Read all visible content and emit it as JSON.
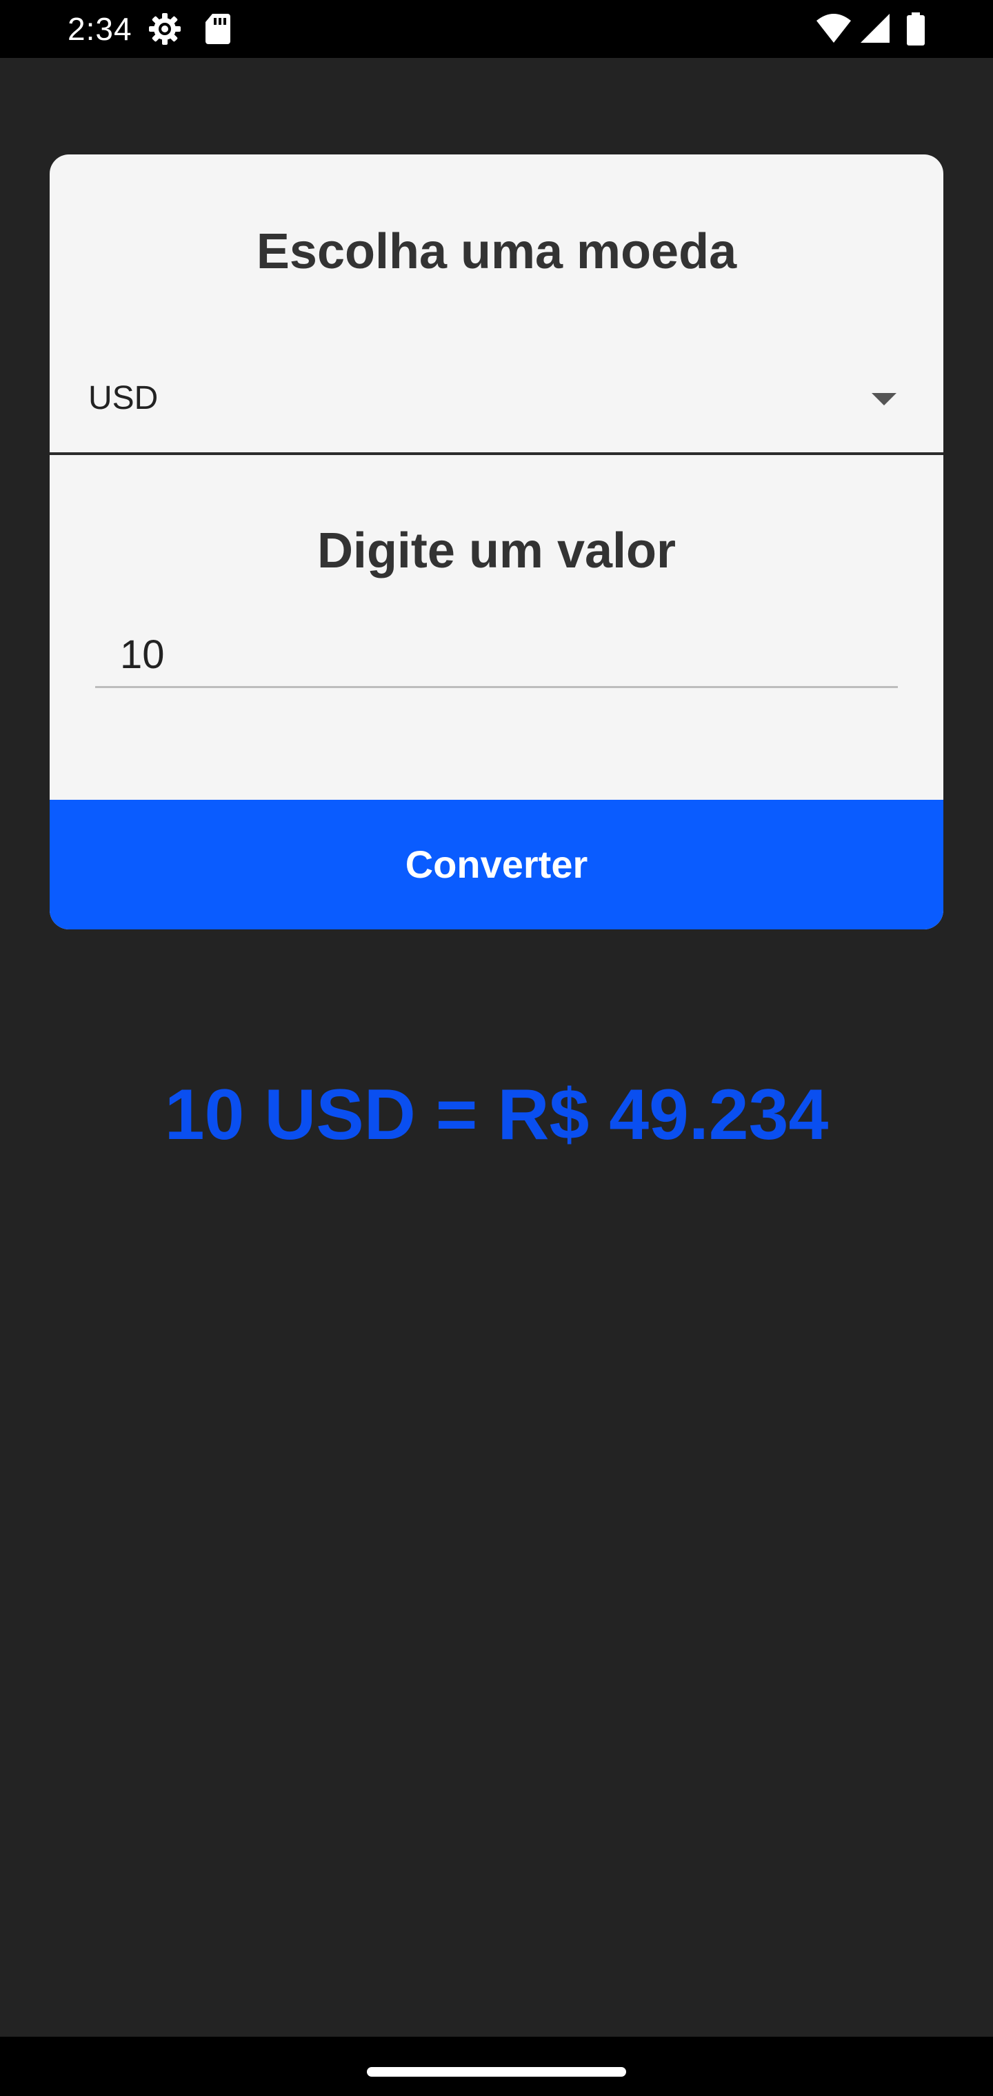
{
  "status_bar": {
    "time": "2:34",
    "icons": [
      "settings-gear-icon",
      "sd-card-icon",
      "wifi-icon",
      "cell-signal-icon",
      "battery-icon"
    ]
  },
  "currency_card": {
    "currency_title": "Escolha uma moeda",
    "selected_currency": "USD",
    "value_title": "Digite um valor",
    "amount_value": "10",
    "convert_label": "Converter"
  },
  "result": {
    "text": "10 USD = R$ 49.234"
  },
  "colors": {
    "background": "#232323",
    "card": "#f5f5f5",
    "accent": "#0a5cff",
    "result": "#0a4ff0"
  }
}
